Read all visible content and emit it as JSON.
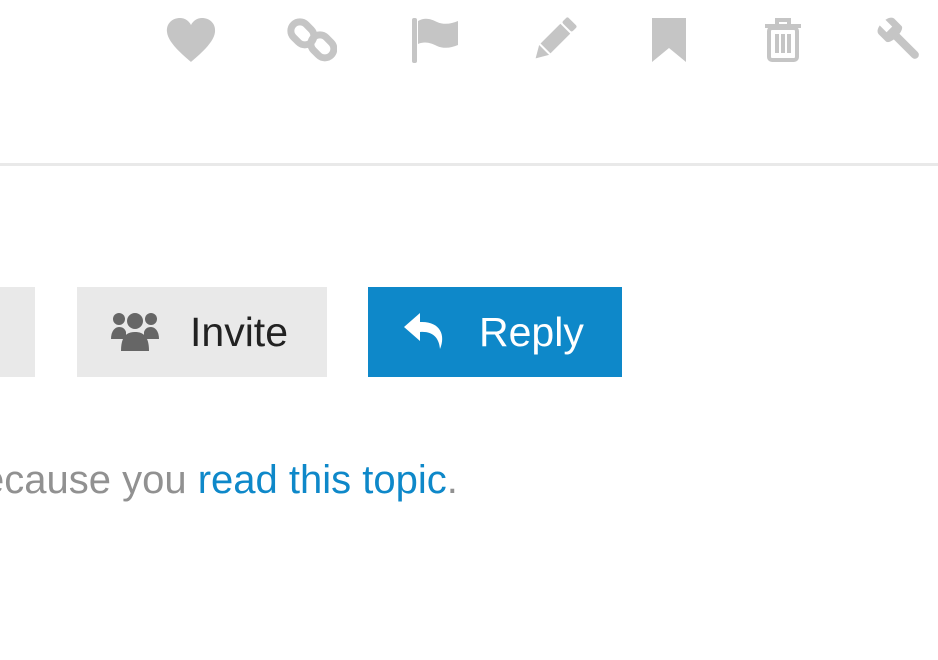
{
  "post_actions": {
    "icons": [
      "heart-icon",
      "link-icon",
      "flag-icon",
      "pencil-icon",
      "bookmark-icon",
      "trash-icon",
      "wrench-icon"
    ],
    "icon_color": "#c5c5c5"
  },
  "footer_buttons": {
    "invite_label": "Invite",
    "reply_label": "Reply"
  },
  "notification_notice": {
    "text_prefix": "ecause you ",
    "link_text": "read this topic",
    "text_suffix": "."
  },
  "colors": {
    "primary": "#0e88c9",
    "button_gray": "#e9e9e9",
    "muted_text": "#919191",
    "icon_gray": "#c5c5c5"
  }
}
